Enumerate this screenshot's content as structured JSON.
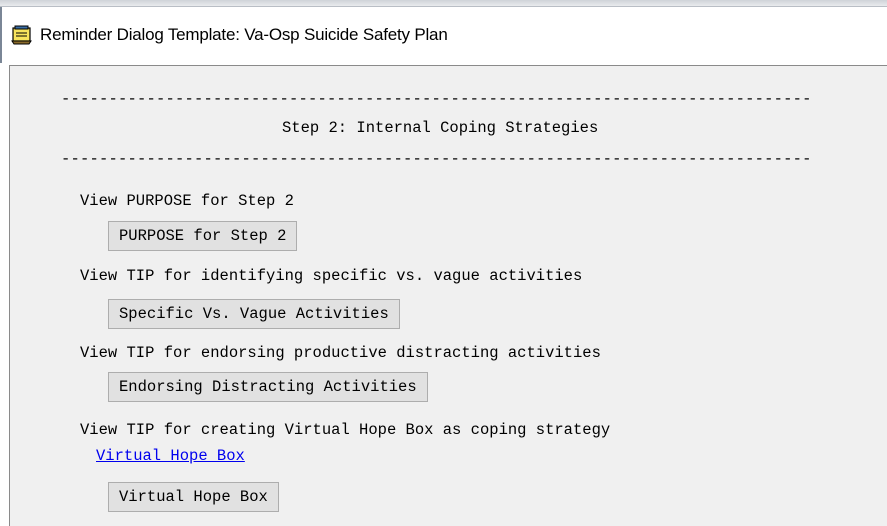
{
  "window": {
    "title": "Reminder Dialog Template: Va-Osp Suicide Safety Plan",
    "icon": "reminder-dialog-icon"
  },
  "content": {
    "divider": "-------------------------------------------------------------------------------",
    "step_heading": "Step 2: Internal Coping Strategies",
    "items": [
      {
        "label": "View PURPOSE for Step 2",
        "button": "PURPOSE for Step 2"
      },
      {
        "label": "View TIP for identifying specific vs. vague activities",
        "button": "Specific Vs. Vague Activities"
      },
      {
        "label": "View TIP for endorsing productive distracting activities",
        "button": "Endorsing Distracting Activities"
      },
      {
        "label": "View TIP for creating Virtual Hope Box as coping strategy",
        "link": "Virtual Hope Box",
        "button": "Virtual Hope Box"
      }
    ]
  },
  "colors": {
    "client_background": "#f0f0f0",
    "button_face": "#e1e1e1",
    "link": "#0000ee"
  }
}
